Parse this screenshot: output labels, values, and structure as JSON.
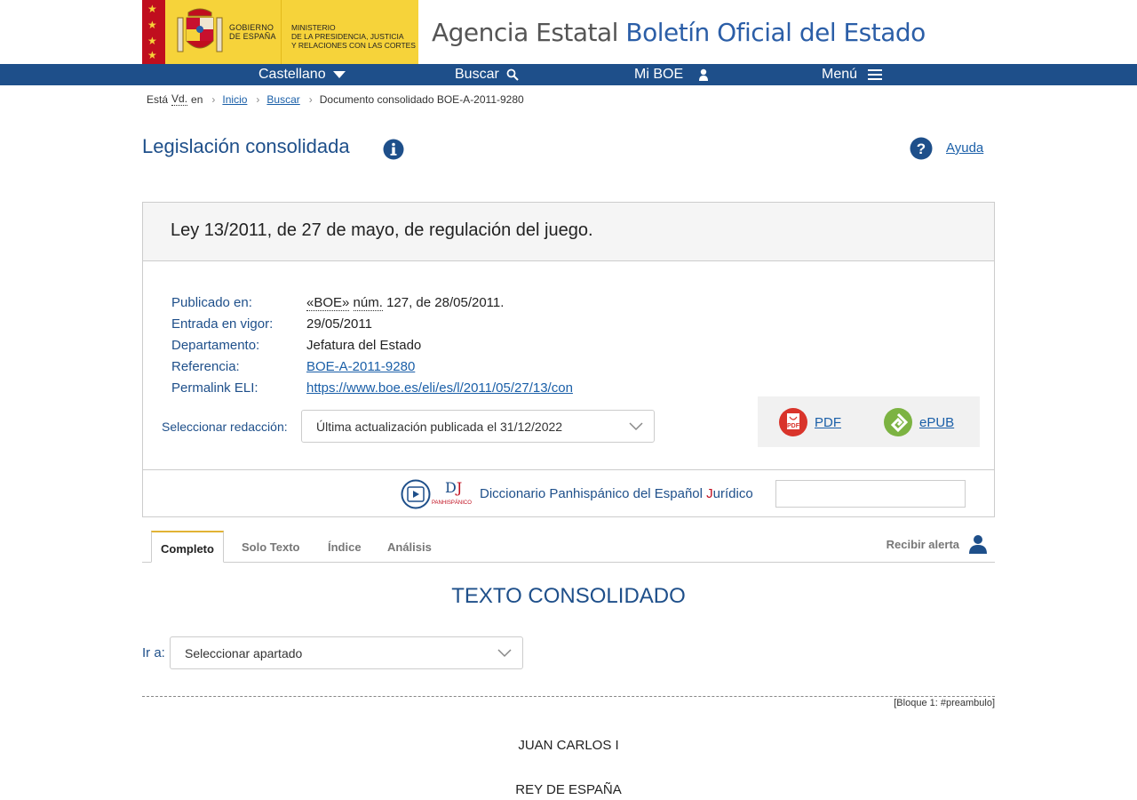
{
  "header": {
    "gov_line1": "GOBIERNO",
    "gov_line2": "DE ESPAÑA",
    "ministry_line1": "MINISTERIO",
    "ministry_line2": "DE LA PRESIDENCIA, JUSTICIA",
    "ministry_line3": "Y RELACIONES CON LAS CORTES",
    "title_part1": "Agencia Estatal ",
    "title_part2": "Boletín Oficial del Estado"
  },
  "nav": {
    "language": "Castellano",
    "search": "Buscar",
    "my_boe": "Mi BOE",
    "menu": "Menú"
  },
  "breadcrumb": {
    "prefix": "Está",
    "abbr": "Vd.",
    "en": "en",
    "home": "Inicio",
    "search": "Buscar",
    "current": "Documento consolidado BOE-A-2011-9280"
  },
  "page": {
    "title": "Legislación consolidada",
    "help": "Ayuda"
  },
  "document": {
    "title": "Ley 13/2011, de 27 de mayo, de regulación del juego.",
    "meta": {
      "published_label": "Publicado en:",
      "published_boe": "«BOE»",
      "published_num": "núm.",
      "published_rest": " 127, de 28/05/2011.",
      "in_force_label": "Entrada en vigor:",
      "in_force_value": "29/05/2011",
      "department_label": "Departamento:",
      "department_value": "Jefatura del Estado",
      "reference_label": "Referencia:",
      "reference_value": "BOE-A-2011-9280",
      "eli_label": "Permalink ELI:",
      "eli_value": "https://www.boe.es/eli/es/l/2011/05/27/13/con"
    },
    "redaction_label": "Seleccionar redacción:",
    "redaction_selected": "Última actualización publicada el 31/12/2022",
    "pdf_label": "PDF",
    "epub_label": "ePUB",
    "dictionary_pre": "Diccionario Panhispánico del Español ",
    "dictionary_j": "J",
    "dictionary_post": "urídico",
    "dictionary_logo": "PANHISPÁNICO"
  },
  "tabs": [
    "Completo",
    "Solo Texto",
    "Índice",
    "Análisis"
  ],
  "alert_label": "Recibir alerta",
  "content": {
    "section_title": "TEXTO CONSOLIDADO",
    "goto_label": "Ir a:",
    "goto_selected": "Seleccionar apartado",
    "block_ref": "[Bloque 1: #preambulo]",
    "line1": "JUAN CARLOS I",
    "line2": "REY DE ESPAÑA"
  },
  "colors": {
    "nav_bg": "#1e4f8a",
    "gov_yellow": "#f6d33a",
    "spain_red": "#c00e1e",
    "tab_accent": "#e2b335"
  }
}
